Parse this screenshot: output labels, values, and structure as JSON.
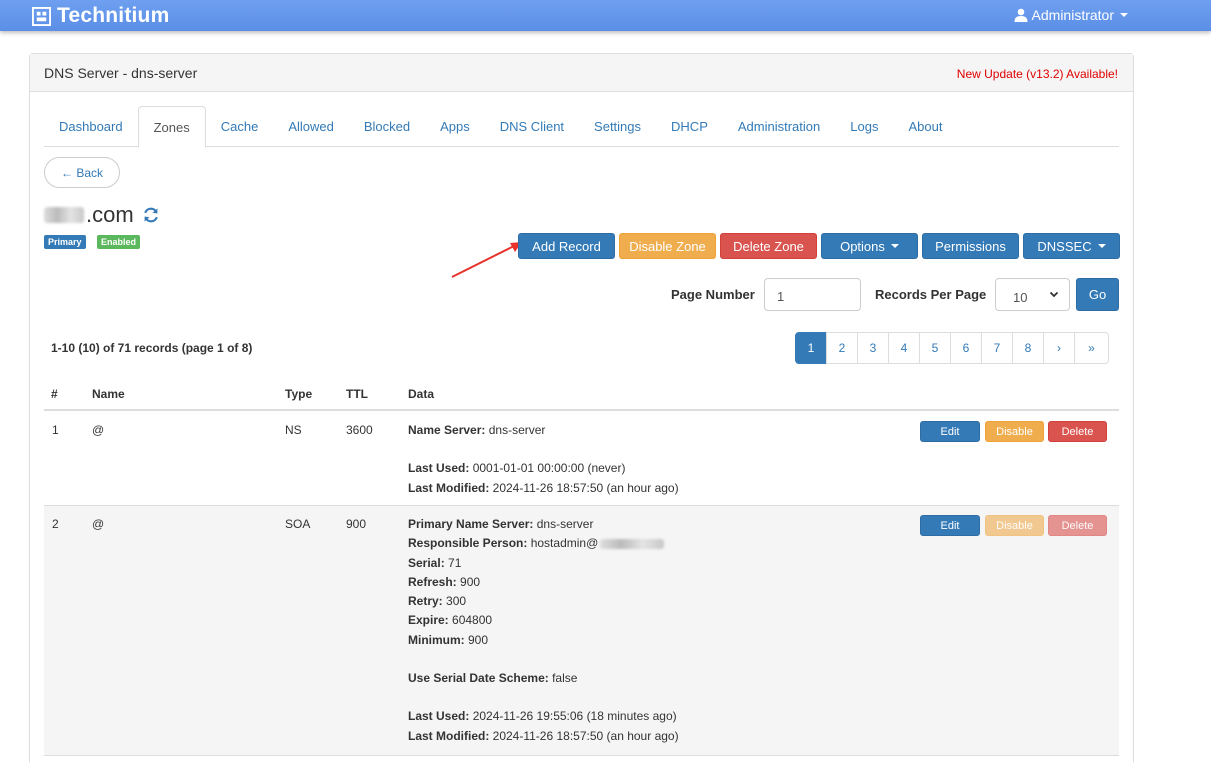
{
  "navbar": {
    "brand": "Technitium",
    "user": "Administrator"
  },
  "panel": {
    "title": "DNS Server - dns-server",
    "update_notice": "New Update (v13.2) Available!"
  },
  "tabs": [
    {
      "label": "Dashboard",
      "active": false
    },
    {
      "label": "Zones",
      "active": true
    },
    {
      "label": "Cache",
      "active": false
    },
    {
      "label": "Allowed",
      "active": false
    },
    {
      "label": "Blocked",
      "active": false
    },
    {
      "label": "Apps",
      "active": false
    },
    {
      "label": "DNS Client",
      "active": false
    },
    {
      "label": "Settings",
      "active": false
    },
    {
      "label": "DHCP",
      "active": false
    },
    {
      "label": "Administration",
      "active": false
    },
    {
      "label": "Logs",
      "active": false
    },
    {
      "label": "About",
      "active": false
    }
  ],
  "back_label": "← Back",
  "zone": {
    "name_suffix": ".com",
    "badge_type": "Primary",
    "badge_status": "Enabled"
  },
  "actions": {
    "add_record": "Add Record",
    "disable_zone": "Disable Zone",
    "delete_zone": "Delete Zone",
    "options": "Options",
    "permissions": "Permissions",
    "dnssec": "DNSSEC"
  },
  "paging": {
    "page_number_label": "Page Number",
    "page_number_value": "1",
    "records_per_page_label": "Records Per Page",
    "records_per_page_value": "10",
    "go_label": "Go",
    "summary": "1-10 (10) of 71 records (page 1 of 8)",
    "pages": [
      "1",
      "2",
      "3",
      "4",
      "5",
      "6",
      "7",
      "8",
      "›",
      "»"
    ],
    "active_page": "1"
  },
  "table": {
    "headers": {
      "num": "#",
      "name": "Name",
      "type": "Type",
      "ttl": "TTL",
      "data": "Data"
    },
    "rows": [
      {
        "num": "1",
        "name": "@",
        "type": "NS",
        "ttl": "3600",
        "ns_label": "Name Server:",
        "ns_value": " dns-server",
        "last_used_label": "Last Used:",
        "last_used_value": " 0001-01-01 00:00:00 (never)",
        "last_modified_label": "Last Modified:",
        "last_modified_value": " 2024-11-26 18:57:50 (an hour ago)",
        "edit": "Edit",
        "disable": "Disable",
        "delete": "Delete"
      },
      {
        "num": "2",
        "name": "@",
        "type": "SOA",
        "ttl": "900",
        "primary_ns_label": "Primary Name Server:",
        "primary_ns_value": " dns-server",
        "responsible_label": "Responsible Person:",
        "responsible_value": " hostadmin@",
        "serial_label": "Serial:",
        "serial_value": " 71",
        "refresh_label": "Refresh:",
        "refresh_value": " 900",
        "retry_label": "Retry:",
        "retry_value": " 300",
        "expire_label": "Expire:",
        "expire_value": " 604800",
        "minimum_label": "Minimum:",
        "minimum_value": " 900",
        "serial_scheme_label": "Use Serial Date Scheme:",
        "serial_scheme_value": " false",
        "last_used_label": "Last Used:",
        "last_used_value": " 2024-11-26 19:55:06 (18 minutes ago)",
        "last_modified_label": "Last Modified:",
        "last_modified_value": " 2024-11-26 18:57:50 (an hour ago)",
        "edit": "Edit",
        "disable": "Disable",
        "delete": "Delete"
      }
    ]
  },
  "colors": {
    "navbar": "#6d9eeb",
    "primary": "#337ab7",
    "warning": "#f0ad4e",
    "danger": "#d9534f",
    "success": "#5cb85c",
    "annotation_arrow": "#e8322b"
  }
}
